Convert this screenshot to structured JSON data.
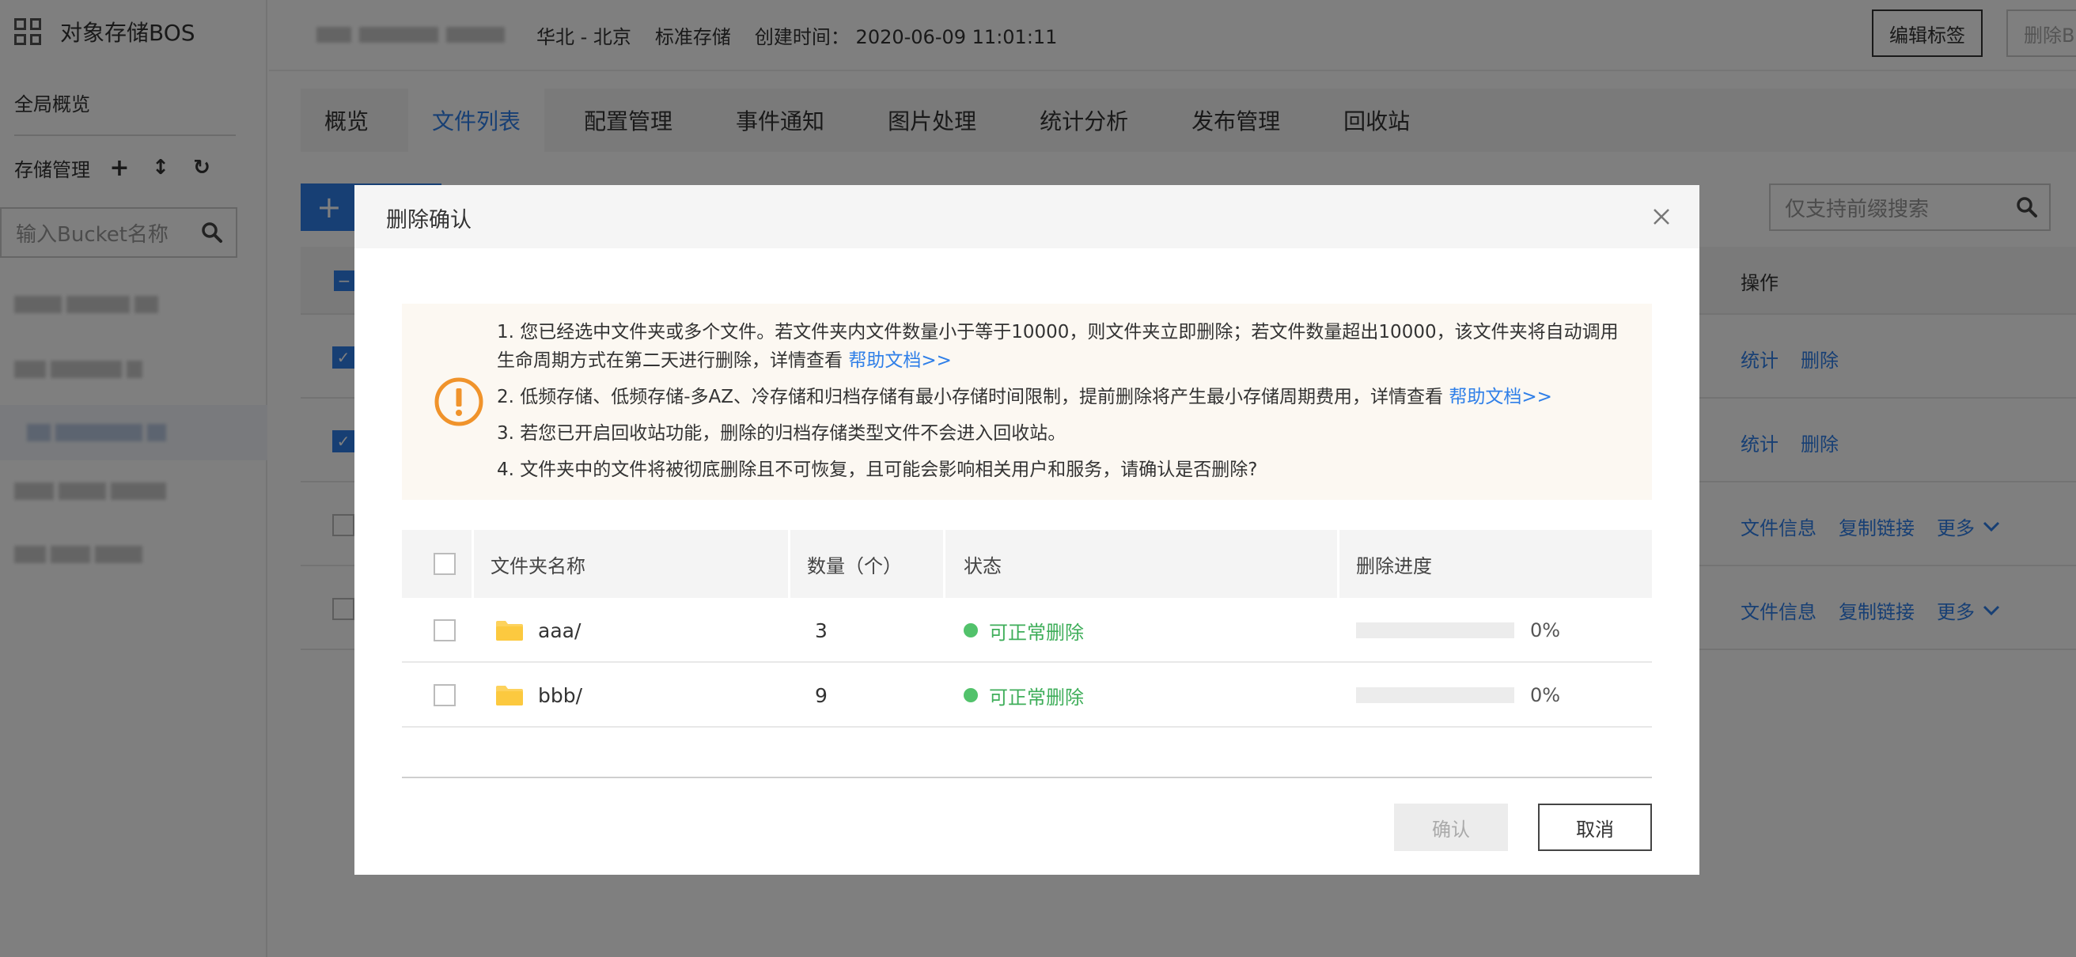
{
  "sidebar": {
    "brand_icon": "grid-apps-icon",
    "title": "对象存储BOS",
    "overview": "全局概览",
    "storage_label": "存储管理",
    "tools": {
      "add": "+",
      "sort": "↕",
      "refresh": "↻"
    },
    "search_placeholder": "输入Bucket名称"
  },
  "header": {
    "region": "华北 - 北京",
    "storage_class": "标准存储",
    "created": "创建时间：  2020-06-09 11:01:11",
    "edit_tags": "编辑标签",
    "delete_bucket": "删除Bu"
  },
  "tabs": [
    {
      "label": "概览"
    },
    {
      "label": "文件列表"
    },
    {
      "label": "配置管理"
    },
    {
      "label": "事件通知"
    },
    {
      "label": "图片处理"
    },
    {
      "label": "统计分析"
    },
    {
      "label": "发布管理"
    },
    {
      "label": "回收站"
    }
  ],
  "toolbar": {
    "add_symbol": "+",
    "prefix_search_placeholder": "仅支持前缀搜索"
  },
  "file_table": {
    "op_header": "操作",
    "rows": [
      {
        "checked": true,
        "actions": [
          "统计",
          "删除"
        ]
      },
      {
        "checked": true,
        "actions": [
          "统计",
          "删除"
        ]
      },
      {
        "checked": false,
        "actions": [
          "文件信息",
          "复制链接",
          "更多"
        ]
      },
      {
        "checked": false,
        "actions": [
          "文件信息",
          "复制链接",
          "更多"
        ]
      }
    ]
  },
  "dialog": {
    "title": "删除确认",
    "warning_icon": "exclamation-circle-icon",
    "notices": {
      "n1": "1. 您已经选中文件夹或多个文件。若文件夹内文件数量小于等于10000，则文件夹立即删除；若文件数量超出10000，该文件夹将自动调用生命周期方式在第二天进行删除，详情查看 ",
      "n1_link": "帮助文档>>",
      "n2": "2. 低频存储、低频存储-多AZ、冷存储和归档存储有最小存储时间限制，提前删除将产生最小存储周期费用，详情查看 ",
      "n2_link": "帮助文档>>",
      "n3": "3. 若您已开启回收站功能，删除的归档存储类型文件不会进入回收站。",
      "n4": "4. 文件夹中的文件将被彻底删除且不可恢复，且可能会影响相关用户和服务，请确认是否删除?"
    },
    "columns": {
      "name": "文件夹名称",
      "count": "数量（个）",
      "status": "状态",
      "progress": "删除进度"
    },
    "folders": [
      {
        "name": "aaa/",
        "count": "3",
        "status": "可正常删除",
        "progress": 0,
        "progress_text": "0%"
      },
      {
        "name": "bbb/",
        "count": "9",
        "status": "可正常删除",
        "progress": 0,
        "progress_text": "0%"
      }
    ],
    "confirm": "确认",
    "cancel": "取消"
  },
  "colors": {
    "accent": "#2f7fe8",
    "status_ok": "#52c26b",
    "warning": "#f0932b"
  }
}
